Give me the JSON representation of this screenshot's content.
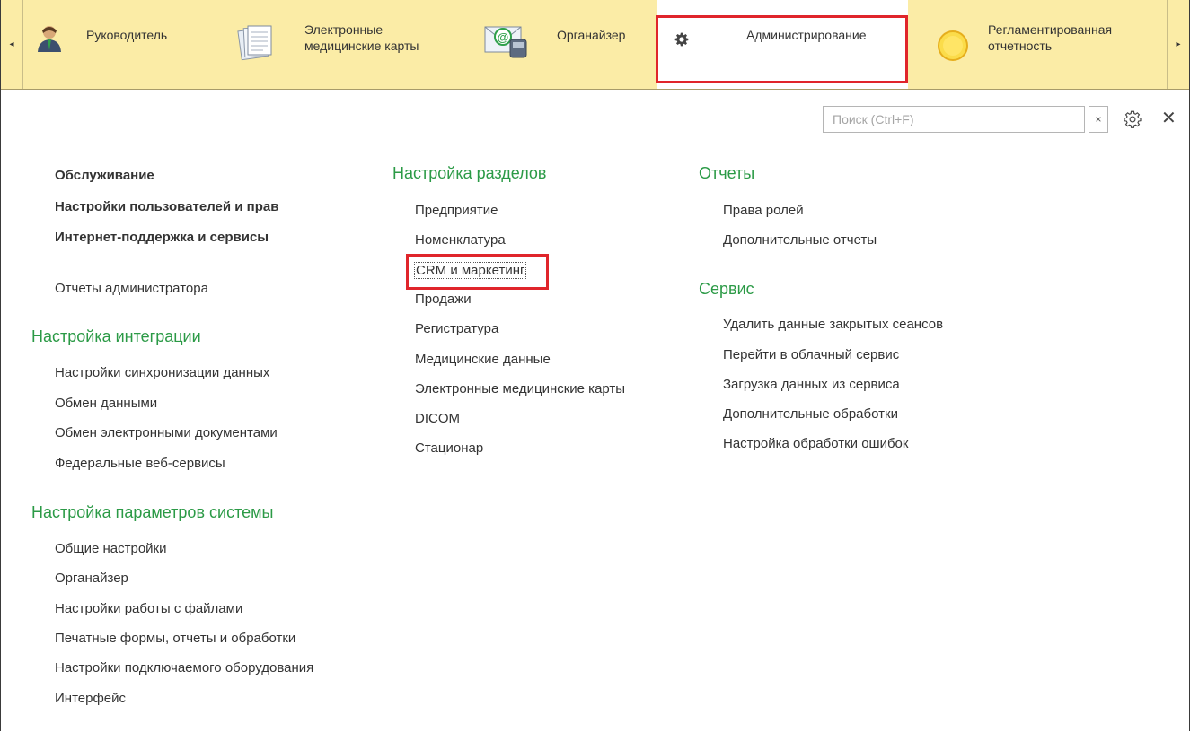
{
  "topbar": {
    "sections": [
      {
        "label_line1": "Руководитель",
        "label_line2": "",
        "icon": "manager-person-icon"
      },
      {
        "label_line1": "Электронные",
        "label_line2": "медицинские карты",
        "icon": "documents-stack-icon"
      },
      {
        "label_line1": "Органайзер",
        "label_line2": "",
        "icon": "email-phone-icon"
      },
      {
        "label_line1": "Администрирование",
        "label_line2": "",
        "icon": "gear-icon"
      },
      {
        "label_line1": "Регламентированная",
        "label_line2": "отчетность",
        "icon": "yellow-circle-icon"
      }
    ],
    "active_index": 3
  },
  "search": {
    "placeholder": "Поиск (Ctrl+F)",
    "clear_label": "×",
    "close_label": "✕"
  },
  "col1": {
    "bold_links": [
      "Обслуживание",
      "Настройки пользователей и прав",
      "Интернет-поддержка и сервисы"
    ],
    "admin_reports": "Отчеты администратора",
    "integration": {
      "title": "Настройка интеграции",
      "links": [
        "Настройки синхронизации данных",
        "Обмен данными",
        "Обмен электронными документами",
        "Федеральные веб-сервисы"
      ]
    },
    "system": {
      "title": "Настройка параметров системы",
      "links": [
        "Общие настройки",
        "Органайзер",
        "Настройки работы с файлами",
        "Печатные формы, отчеты и обработки",
        "Настройки подключаемого оборудования",
        "Интерфейс"
      ]
    }
  },
  "col2": {
    "title": "Настройка разделов",
    "links": [
      "Предприятие",
      "Номенклатура",
      "CRM и маркетинг",
      "Продажи",
      "Регистратура",
      "Медицинские данные",
      "Электронные медицинские карты",
      "DICOM",
      "Стационар"
    ],
    "focused_index": 2
  },
  "col3": {
    "reports": {
      "title": "Отчеты",
      "links": [
        "Права ролей",
        "Дополнительные отчеты"
      ]
    },
    "service": {
      "title": "Сервис",
      "links": [
        "Удалить данные закрытых сеансов",
        "Перейти в облачный сервис",
        "Загрузка данных из сервиса",
        "Дополнительные обработки",
        "Настройка обработки ошибок"
      ]
    }
  },
  "colors": {
    "heading": "#2b9a46",
    "topbar": "#fbeca6",
    "highlight": "#e0252b"
  }
}
